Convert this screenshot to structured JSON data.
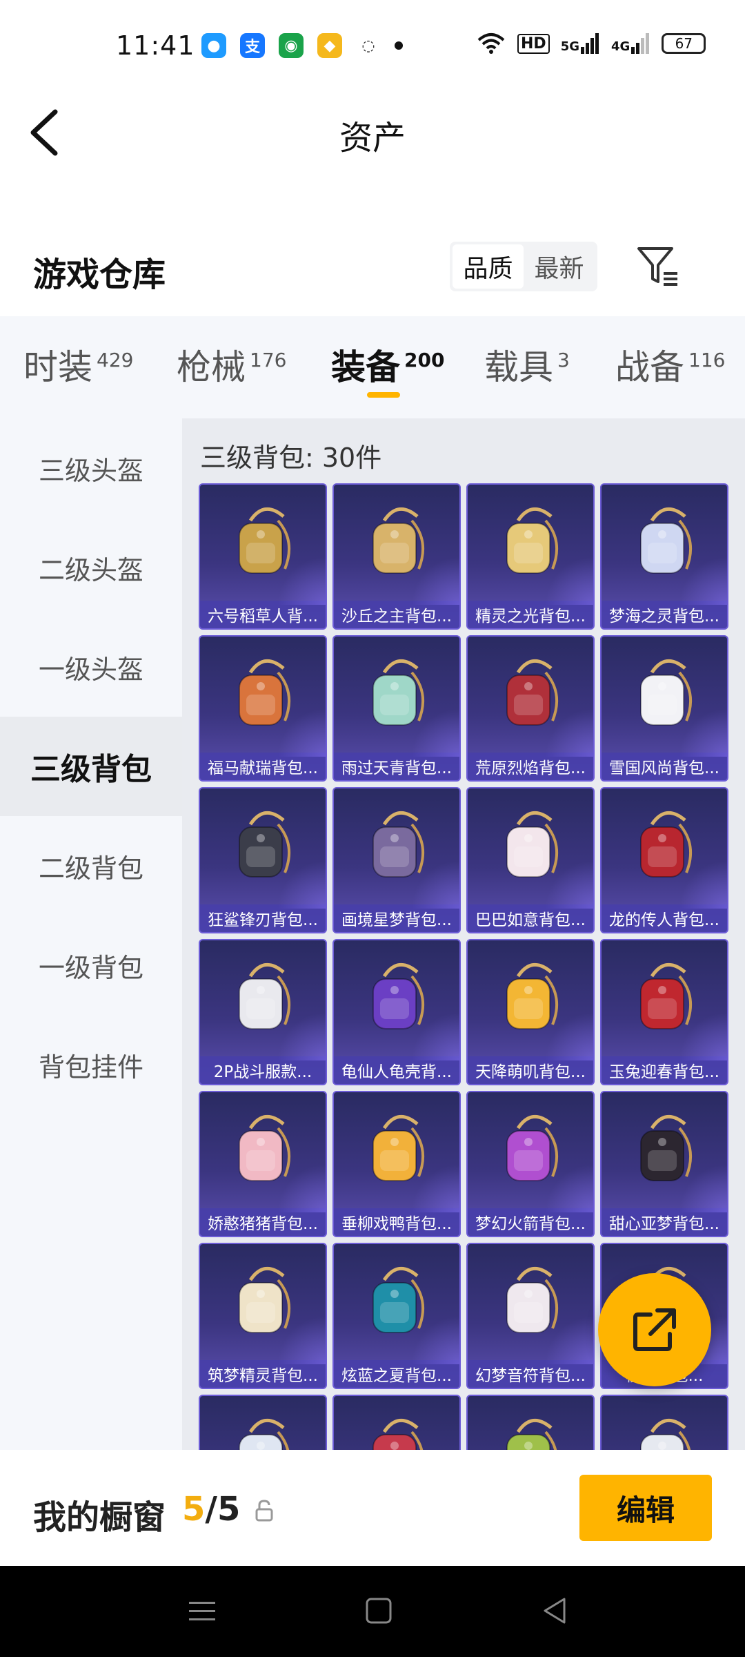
{
  "status_bar": {
    "time": "11:41",
    "network_labels": [
      "HD",
      "5G",
      "4G"
    ],
    "battery": "67",
    "app_icons": [
      "qq-icon",
      "alipay-icon",
      "panda-app-icon",
      "diamond-app-icon",
      "chat-bubble-icon"
    ]
  },
  "header": {
    "title": "资产"
  },
  "warehouse": {
    "title": "游戏仓库",
    "sort_options": [
      {
        "label": "品质",
        "active": true
      },
      {
        "label": "最新",
        "active": false
      }
    ]
  },
  "category_tabs": [
    {
      "label": "时装",
      "count": "429",
      "active": false
    },
    {
      "label": "枪械",
      "count": "176",
      "active": false
    },
    {
      "label": "装备",
      "count": "200",
      "active": true
    },
    {
      "label": "载具",
      "count": "3",
      "active": false
    },
    {
      "label": "战备",
      "count": "116",
      "active": false
    }
  ],
  "sidebar": {
    "items": [
      {
        "label": "三级头盔",
        "active": false
      },
      {
        "label": "二级头盔",
        "active": false
      },
      {
        "label": "一级头盔",
        "active": false
      },
      {
        "label": "三级背包",
        "active": true
      },
      {
        "label": "二级背包",
        "active": false
      },
      {
        "label": "一级背包",
        "active": false
      },
      {
        "label": "背包挂件",
        "active": false
      }
    ]
  },
  "content": {
    "section_title": "三级背包: 30件",
    "items": [
      {
        "name": "六号稻草人背...",
        "color": "#c9a24a"
      },
      {
        "name": "沙丘之主背包...",
        "color": "#d8b36a"
      },
      {
        "name": "精灵之光背包...",
        "color": "#e6c979"
      },
      {
        "name": "梦海之灵背包...",
        "color": "#cfd7f2"
      },
      {
        "name": "福马献瑞背包...",
        "color": "#d9743c"
      },
      {
        "name": "雨过天青背包...",
        "color": "#9fd7c8"
      },
      {
        "name": "荒原烈焰背包...",
        "color": "#b0303a"
      },
      {
        "name": "雪国风尚背包...",
        "color": "#f2f2f6"
      },
      {
        "name": "狂鲨锋刃背包...",
        "color": "#3b3d4a"
      },
      {
        "name": "画境星梦背包...",
        "color": "#7a6a9e"
      },
      {
        "name": "巴巴如意背包...",
        "color": "#f3e6ec"
      },
      {
        "name": "龙的传人背包...",
        "color": "#b8262f"
      },
      {
        "name": "2P战斗服款...",
        "color": "#e9e9ee"
      },
      {
        "name": "龟仙人龟壳背...",
        "color": "#6b3fc4"
      },
      {
        "name": "天降萌叽背包...",
        "color": "#f3b634"
      },
      {
        "name": "玉兔迎春背包...",
        "color": "#c0272f"
      },
      {
        "name": "娇憨猪猪背包...",
        "color": "#f1b9c4"
      },
      {
        "name": "垂柳戏鸭背包...",
        "color": "#f2b13a"
      },
      {
        "name": "梦幻火箭背包...",
        "color": "#b04fd0"
      },
      {
        "name": "甜心亚梦背包...",
        "color": "#2c2630"
      },
      {
        "name": "筑梦精灵背包...",
        "color": "#efe3c8"
      },
      {
        "name": "炫蓝之夏背包...",
        "color": "#1f8fa8"
      },
      {
        "name": "幻梦音符背包...",
        "color": "#efe8ee"
      },
      {
        "name": "樱...背包...",
        "color": "#f4c28c"
      },
      {
        "name": "",
        "color": "#dfe6f2"
      },
      {
        "name": "",
        "color": "#c63a4c"
      },
      {
        "name": "",
        "color": "#9fc04a"
      },
      {
        "name": "",
        "color": "#e6e9f0"
      }
    ]
  },
  "bottom_bar": {
    "showcase_label": "我的橱窗",
    "showcase_current": "5",
    "showcase_separator": "/",
    "showcase_total": "5",
    "edit_label": "编辑"
  },
  "colors": {
    "accent": "#ffb400",
    "card_bg": "#3b3580",
    "panel_bg": "#f5f7fb"
  }
}
